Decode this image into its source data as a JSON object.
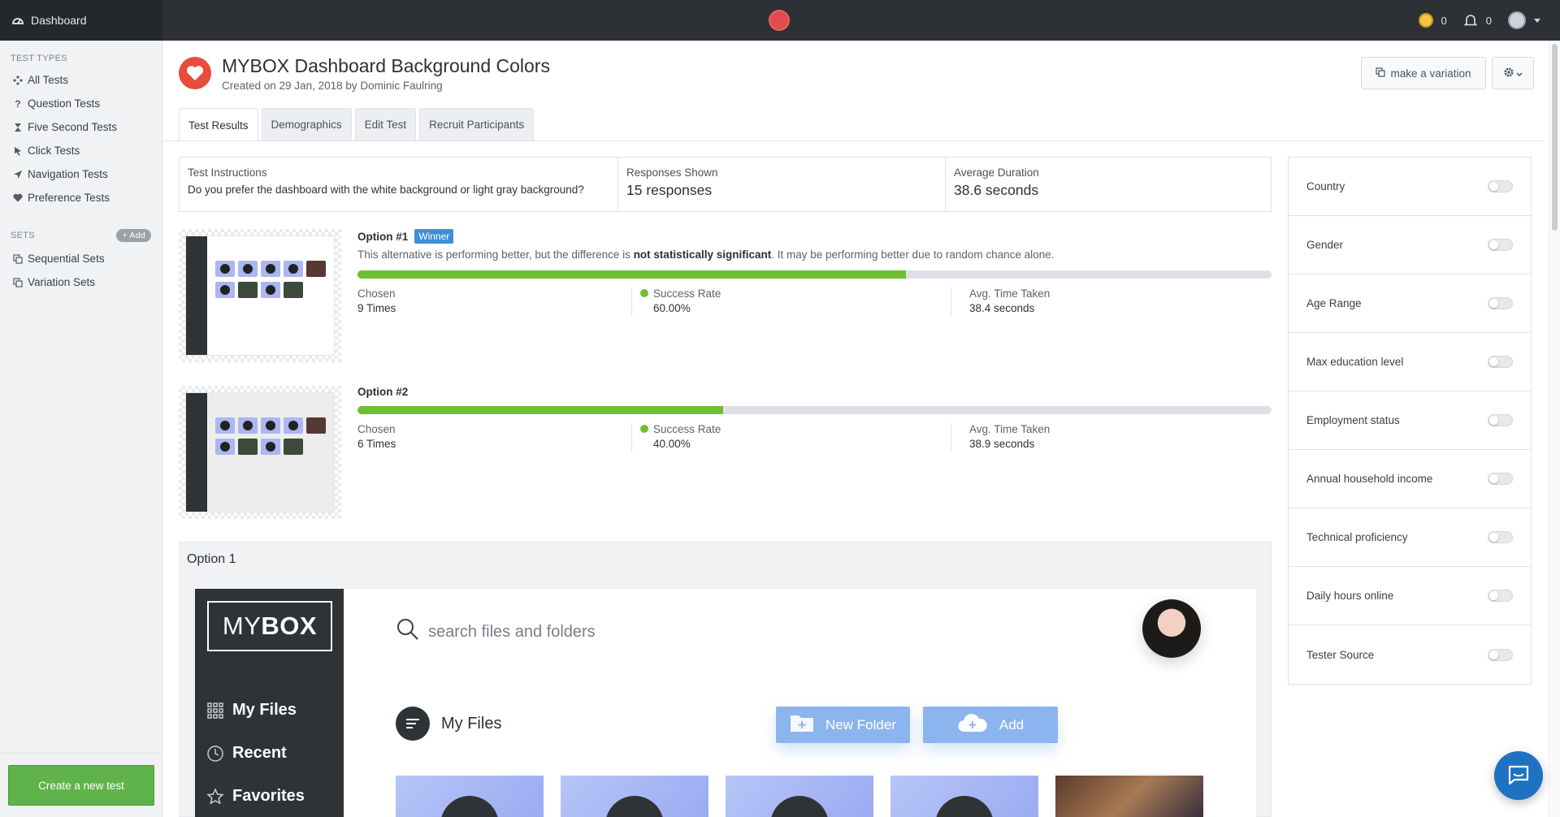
{
  "topbar": {
    "dashboard_label": "Dashboard",
    "coins_count": "0",
    "notifications_count": "0"
  },
  "sidebar": {
    "test_types_heading": "TEST TYPES",
    "items": [
      {
        "label": "All Tests",
        "icon": "sitemap-icon"
      },
      {
        "label": "Question Tests",
        "icon": "question-icon"
      },
      {
        "label": "Five Second Tests",
        "icon": "hourglass-icon"
      },
      {
        "label": "Click Tests",
        "icon": "cursor-icon"
      },
      {
        "label": "Navigation Tests",
        "icon": "location-arrow-icon"
      },
      {
        "label": "Preference Tests",
        "icon": "heart-icon"
      }
    ],
    "sets_heading": "SETS",
    "add_label": "+ Add",
    "sets": [
      {
        "label": "Sequential Sets",
        "icon": "copy-icon"
      },
      {
        "label": "Variation Sets",
        "icon": "copy-icon"
      }
    ],
    "create_button": "Create a new test"
  },
  "header": {
    "title": "MYBOX Dashboard Background Colors",
    "subtitle": "Created on 29 Jan, 2018 by Dominic Faulring",
    "variation_button": "make a variation"
  },
  "tabs": [
    {
      "label": "Test Results",
      "active": true
    },
    {
      "label": "Demographics",
      "active": false
    },
    {
      "label": "Edit Test",
      "active": false
    },
    {
      "label": "Recruit Participants",
      "active": false
    }
  ],
  "summary": {
    "instructions_label": "Test Instructions",
    "instructions_text": "Do you prefer the dashboard with the white background or light gray background?",
    "responses_label": "Responses Shown",
    "responses_value": "15 responses",
    "duration_label": "Average Duration",
    "duration_value": "38.6 seconds"
  },
  "options": [
    {
      "name": "Option #1",
      "badge": "Winner",
      "note_pre": "This alternative is performing better, but the difference is ",
      "note_bold": "not statistically significant",
      "note_post": ". It may be performing better due to random chance alone.",
      "share": 0.6,
      "chosen_label": "Chosen",
      "chosen_value": "9 Times",
      "success_label": "Success Rate",
      "success_value": "60.00%",
      "time_label": "Avg. Time Taken",
      "time_value": "38.4 seconds"
    },
    {
      "name": "Option #2",
      "share": 0.4,
      "chosen_label": "Chosen",
      "chosen_value": "6 Times",
      "success_label": "Success Rate",
      "success_value": "40.00%",
      "time_label": "Avg. Time Taken",
      "time_value": "38.9 seconds"
    }
  ],
  "preview": {
    "title": "Option 1",
    "logo_light": "MY",
    "logo_bold": "BOX",
    "nav": [
      "My Files",
      "Recent",
      "Favorites"
    ],
    "search_placeholder": "search files and folders",
    "section_title": "My Files",
    "new_folder": "New Folder",
    "add": "Add"
  },
  "filters": [
    "Country",
    "Gender",
    "Age Range",
    "Max education level",
    "Employment status",
    "Annual household income",
    "Technical proficiency",
    "Daily hours online",
    "Tester Source"
  ],
  "colors": {
    "accent": "#3e8ed8",
    "success": "#6fbf31",
    "create_button": "#5fb34a",
    "topbar": "#2d3035",
    "heart": "#e74c3c",
    "chat": "#1f72c2"
  }
}
